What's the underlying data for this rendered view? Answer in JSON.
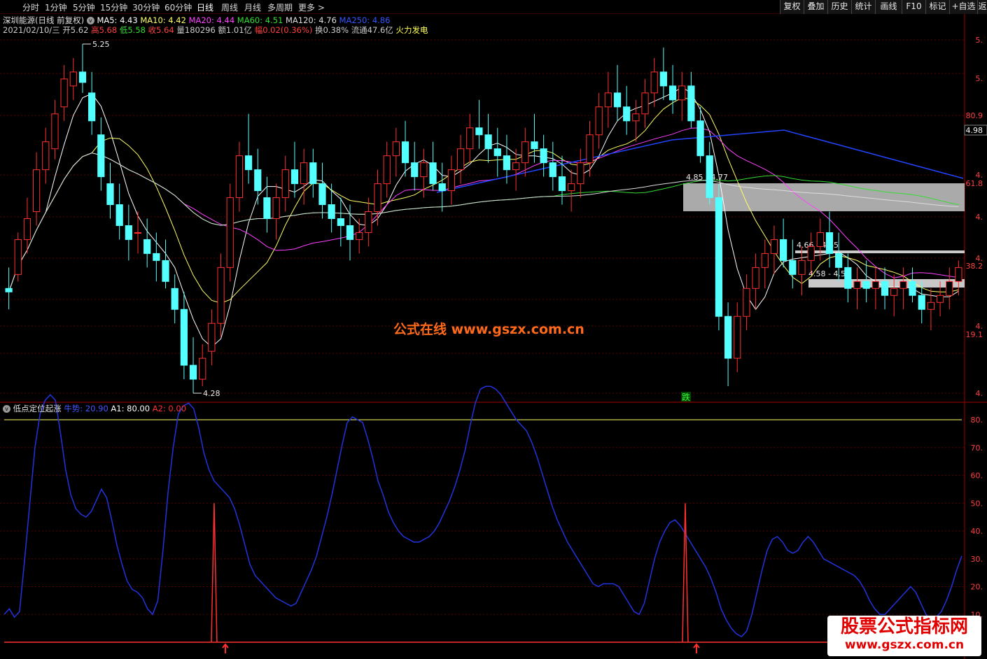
{
  "toolbar": {
    "periods": [
      "分时",
      "1分钟",
      "5分钟",
      "15分钟",
      "30分钟",
      "60分钟",
      "日线",
      "周线",
      "月线",
      "多周期",
      "更多 >"
    ],
    "active_period": "日线",
    "right_buttons": [
      "复权",
      "叠加",
      "历史",
      "统计",
      "画线",
      "F10",
      "标记",
      "+自选",
      "返"
    ]
  },
  "header": {
    "stock": "深圳能源(日线 前复权)",
    "ma": [
      {
        "label": "MA5: 4.43",
        "color": "#ffffff"
      },
      {
        "label": "MA10: 4.42",
        "color": "#ffff66"
      },
      {
        "label": "MA20: 4.44",
        "color": "#ff40ff"
      },
      {
        "label": "MA60: 4.51",
        "color": "#33dd33"
      },
      {
        "label": "MA120: 4.76",
        "color": "#dddddd"
      },
      {
        "label": "MA250: 4.86",
        "color": "#3355ff"
      }
    ],
    "quote": [
      {
        "t": "2021/02/10/三",
        "c": "#cccccc"
      },
      {
        "t": "开5.62",
        "c": "#cccccc"
      },
      {
        "t": "高5.68",
        "c": "#ff4040"
      },
      {
        "t": "低5.58",
        "c": "#33dd33"
      },
      {
        "t": "收5.64",
        "c": "#ff4040"
      },
      {
        "t": "量180296",
        "c": "#cccccc"
      },
      {
        "t": "额1.01亿",
        "c": "#cccccc"
      },
      {
        "t": "幅0.02(0.36%)",
        "c": "#ff4040"
      },
      {
        "t": "换0.38%",
        "c": "#cccccc"
      },
      {
        "t": "流通47.6亿",
        "c": "#cccccc"
      },
      {
        "t": "火力发电",
        "c": "#ffff55"
      }
    ]
  },
  "annotations": {
    "high": "5.25",
    "low": "4.28",
    "zone1": "4.85 - 4.77",
    "zone2": "4.66 - 4.65",
    "zone3": "4.58 - 4.56",
    "fall_marker": "跌",
    "current_price": "4.98"
  },
  "price_axis": [
    "5.",
    "5.",
    "80.9",
    "4.98",
    "4.",
    "61.8",
    "4.",
    "4.",
    "38.2",
    "4.",
    "19.1",
    "4."
  ],
  "indicator": {
    "name": "低点定位起涨",
    "legend": [
      {
        "label": "牛势: 20.90",
        "color": "#4455ff"
      },
      {
        "label": "A1: 80.00",
        "color": "#ffffff"
      },
      {
        "label": "A2: 0.00",
        "color": "#ff3030"
      }
    ],
    "axis": [
      "80.",
      "70.",
      "60.",
      "50.",
      "40.",
      "30.",
      "20.",
      "10."
    ],
    "axis_values": [
      80,
      70,
      60,
      50,
      40,
      30,
      20,
      10
    ],
    "a1_level": 80,
    "a2_level": 0,
    "bull_line": [
      10,
      12,
      9,
      11,
      30,
      50,
      70,
      82,
      87,
      89,
      87,
      75,
      62,
      53,
      48,
      46,
      45,
      47,
      51,
      55,
      52,
      44,
      35,
      28,
      22,
      19,
      18,
      16,
      12,
      10,
      15,
      33,
      54,
      70,
      82,
      85,
      86,
      84,
      77,
      68,
      62,
      58,
      56,
      54,
      52,
      48,
      42,
      35,
      28,
      24,
      22,
      20,
      18,
      16,
      15,
      14,
      13,
      14,
      18,
      22,
      26,
      31,
      38,
      45,
      53,
      62,
      71,
      79,
      81,
      80,
      79,
      73,
      66,
      58,
      53,
      47,
      43,
      40,
      38,
      37,
      36,
      36,
      37,
      38,
      40,
      43,
      47,
      51,
      56,
      62,
      69,
      78,
      86,
      91,
      92,
      92,
      91,
      89,
      86,
      83,
      80,
      78,
      76,
      72,
      67,
      61,
      55,
      49,
      44,
      40,
      36,
      33,
      30,
      27,
      24,
      21,
      20,
      21,
      21,
      21,
      20,
      17,
      14,
      11,
      10,
      14,
      22,
      30,
      36,
      40,
      43,
      44,
      42,
      39,
      36,
      33,
      30,
      27,
      23,
      18,
      12,
      8,
      5,
      3,
      2,
      4,
      10,
      18,
      26,
      33,
      37,
      38,
      36,
      33,
      32,
      33,
      36,
      38,
      36,
      33,
      30,
      29,
      28,
      27,
      26,
      25,
      24,
      22,
      19,
      15,
      12,
      10,
      10,
      12,
      14,
      16,
      18,
      20,
      18,
      14,
      10,
      8,
      9,
      11,
      15,
      20,
      26,
      31
    ],
    "signal_index": [
      41,
      133
    ],
    "signal_height": 50
  },
  "chart_data": {
    "type": "candlestick",
    "note_axis": "price (CNY)",
    "ylim": [
      4.24,
      5.3
    ],
    "candles": [
      [
        4.56,
        4.62,
        4.5,
        4.55
      ],
      [
        4.6,
        4.72,
        4.58,
        4.7
      ],
      [
        4.7,
        4.82,
        4.66,
        4.76
      ],
      [
        4.78,
        4.95,
        4.74,
        4.9
      ],
      [
        4.9,
        5.02,
        4.86,
        4.98
      ],
      [
        4.96,
        5.1,
        4.93,
        5.06
      ],
      [
        5.08,
        5.2,
        5.04,
        5.16
      ],
      [
        5.14,
        5.22,
        5.1,
        5.18
      ],
      [
        5.18,
        5.26,
        5.12,
        5.15
      ],
      [
        5.12,
        5.18,
        5.0,
        5.04
      ],
      [
        5.0,
        5.05,
        4.84,
        4.88
      ],
      [
        4.86,
        4.92,
        4.76,
        4.8
      ],
      [
        4.8,
        4.86,
        4.7,
        4.74
      ],
      [
        4.74,
        4.8,
        4.64,
        4.7
      ],
      [
        4.72,
        4.78,
        4.66,
        4.72
      ],
      [
        4.7,
        4.76,
        4.62,
        4.66
      ],
      [
        4.66,
        4.72,
        4.58,
        4.64
      ],
      [
        4.64,
        4.7,
        4.56,
        4.58
      ],
      [
        4.56,
        4.6,
        4.46,
        4.5
      ],
      [
        4.5,
        4.55,
        4.3,
        4.34
      ],
      [
        4.34,
        4.42,
        4.26,
        4.3
      ],
      [
        4.3,
        4.4,
        4.28,
        4.36
      ],
      [
        4.38,
        4.5,
        4.34,
        4.46
      ],
      [
        4.46,
        4.66,
        4.42,
        4.62
      ],
      [
        4.62,
        4.86,
        4.58,
        4.82
      ],
      [
        4.82,
        4.98,
        4.78,
        4.94
      ],
      [
        4.94,
        5.06,
        4.86,
        4.9
      ],
      [
        4.9,
        4.96,
        4.8,
        4.84
      ],
      [
        4.82,
        4.88,
        4.72,
        4.76
      ],
      [
        4.76,
        4.86,
        4.7,
        4.82
      ],
      [
        4.82,
        4.94,
        4.78,
        4.9
      ],
      [
        4.9,
        4.98,
        4.82,
        4.86
      ],
      [
        4.86,
        4.96,
        4.8,
        4.92
      ],
      [
        4.92,
        4.96,
        4.82,
        4.86
      ],
      [
        4.86,
        4.92,
        4.76,
        4.8
      ],
      [
        4.8,
        4.86,
        4.72,
        4.76
      ],
      [
        4.76,
        4.82,
        4.68,
        4.74
      ],
      [
        4.74,
        4.8,
        4.64,
        4.7
      ],
      [
        4.7,
        4.76,
        4.66,
        4.72
      ],
      [
        4.72,
        4.82,
        4.68,
        4.78
      ],
      [
        4.78,
        4.9,
        4.74,
        4.86
      ],
      [
        4.86,
        4.98,
        4.82,
        4.94
      ],
      [
        4.94,
        5.02,
        4.88,
        4.98
      ],
      [
        4.98,
        5.04,
        4.88,
        4.92
      ],
      [
        4.92,
        4.98,
        4.84,
        4.88
      ],
      [
        4.88,
        4.96,
        4.82,
        4.92
      ],
      [
        4.92,
        4.98,
        4.84,
        4.86
      ],
      [
        4.86,
        4.92,
        4.78,
        4.84
      ],
      [
        4.84,
        4.94,
        4.8,
        4.9
      ],
      [
        4.9,
        5.0,
        4.86,
        4.96
      ],
      [
        4.96,
        5.06,
        4.92,
        5.02
      ],
      [
        5.02,
        5.1,
        4.96,
        5.0
      ],
      [
        5.0,
        5.06,
        4.92,
        4.96
      ],
      [
        4.96,
        5.02,
        4.88,
        4.94
      ],
      [
        4.94,
        5.0,
        4.86,
        4.9
      ],
      [
        4.9,
        4.96,
        4.84,
        4.92
      ],
      [
        4.92,
        5.02,
        4.88,
        4.98
      ],
      [
        4.98,
        5.06,
        4.92,
        4.96
      ],
      [
        4.96,
        5.0,
        4.88,
        4.92
      ],
      [
        4.92,
        4.98,
        4.84,
        4.88
      ],
      [
        4.88,
        4.94,
        4.8,
        4.84
      ],
      [
        4.84,
        4.9,
        4.78,
        4.86
      ],
      [
        4.86,
        4.96,
        4.82,
        4.92
      ],
      [
        4.92,
        5.04,
        4.88,
        5.0
      ],
      [
        5.0,
        5.12,
        4.96,
        5.08
      ],
      [
        5.08,
        5.18,
        5.02,
        5.12
      ],
      [
        5.12,
        5.2,
        5.04,
        5.08
      ],
      [
        5.08,
        5.14,
        5.0,
        5.04
      ],
      [
        5.04,
        5.1,
        4.98,
        5.06
      ],
      [
        5.06,
        5.16,
        5.02,
        5.12
      ],
      [
        5.12,
        5.22,
        5.08,
        5.18
      ],
      [
        5.18,
        5.25,
        5.1,
        5.14
      ],
      [
        5.14,
        5.2,
        5.06,
        5.1
      ],
      [
        5.1,
        5.18,
        5.04,
        5.14
      ],
      [
        5.14,
        5.18,
        5.02,
        5.04
      ],
      [
        5.04,
        5.08,
        4.92,
        4.94
      ],
      [
        4.94,
        4.98,
        4.8,
        4.82
      ],
      [
        4.82,
        4.86,
        4.44,
        4.48
      ],
      [
        4.48,
        4.52,
        4.28,
        4.36
      ],
      [
        4.36,
        4.52,
        4.32,
        4.48
      ],
      [
        4.48,
        4.6,
        4.44,
        4.56
      ],
      [
        4.56,
        4.66,
        4.5,
        4.62
      ],
      [
        4.62,
        4.7,
        4.56,
        4.66
      ],
      [
        4.66,
        4.74,
        4.6,
        4.7
      ],
      [
        4.7,
        4.76,
        4.62,
        4.64
      ],
      [
        4.64,
        4.7,
        4.56,
        4.6
      ],
      [
        4.6,
        4.68,
        4.54,
        4.64
      ],
      [
        4.64,
        4.72,
        4.6,
        4.68
      ],
      [
        4.68,
        4.76,
        4.64,
        4.72
      ],
      [
        4.72,
        4.78,
        4.62,
        4.66
      ],
      [
        4.66,
        4.72,
        4.58,
        4.62
      ],
      [
        4.62,
        4.66,
        4.52,
        4.56
      ],
      [
        4.56,
        4.62,
        4.5,
        4.58
      ],
      [
        4.58,
        4.64,
        4.52,
        4.56
      ],
      [
        4.56,
        4.62,
        4.5,
        4.58
      ],
      [
        4.58,
        4.62,
        4.5,
        4.54
      ],
      [
        4.54,
        4.6,
        4.48,
        4.56
      ],
      [
        4.56,
        4.62,
        4.5,
        4.58
      ],
      [
        4.58,
        4.62,
        4.52,
        4.54
      ],
      [
        4.54,
        4.58,
        4.46,
        4.5
      ],
      [
        4.5,
        4.56,
        4.44,
        4.52
      ],
      [
        4.52,
        4.58,
        4.48,
        4.54
      ],
      [
        4.54,
        4.62,
        4.5,
        4.58
      ],
      [
        4.58,
        4.64,
        4.54,
        4.62
      ]
    ]
  }
}
